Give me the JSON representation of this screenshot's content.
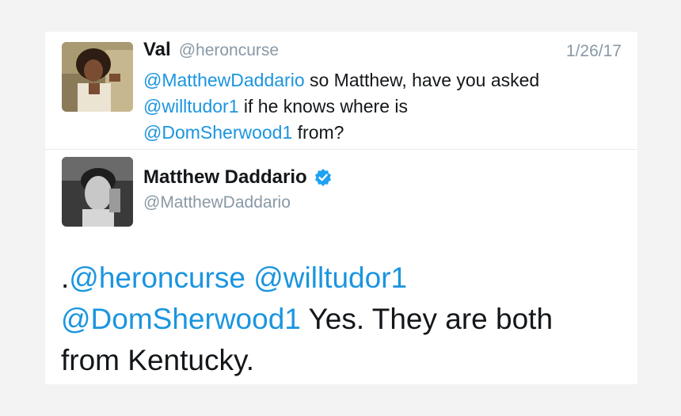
{
  "reply": {
    "name": "Val",
    "handle": "@heroncurse",
    "date": "1/26/17",
    "mention1": "@MatthewDaddario",
    "text1": " so Matthew, have you asked ",
    "mention2": "@willtudor1",
    "text2": " if he knows where is ",
    "mention3": "@DomSherwood1",
    "text3": " from?"
  },
  "tweet": {
    "name": "Matthew Daddario",
    "handle": "@MatthewDaddario",
    "verified_icon": "verified-badge-icon",
    "prefix": ".",
    "mention1": "@heroncurse",
    "mention2": "@willtudor1",
    "mention3": "@DomSherwood1",
    "body": " Yes. They are both from Kentucky."
  },
  "colors": {
    "mention": "#1b95e0",
    "muted": "#8899a6",
    "text": "#14171a",
    "verified": "#1da1f2"
  }
}
